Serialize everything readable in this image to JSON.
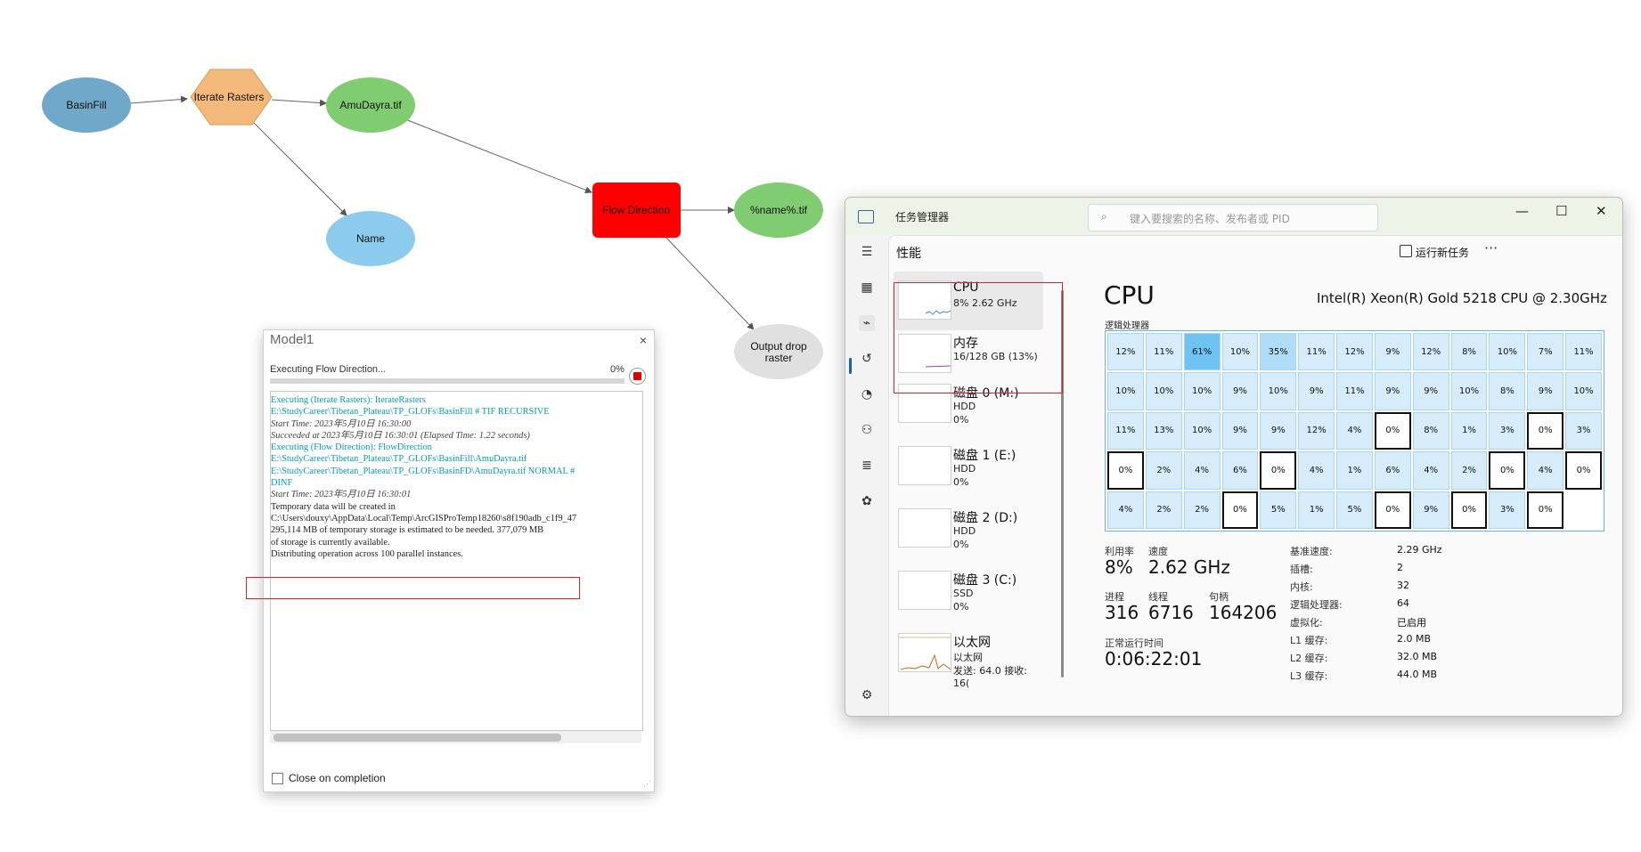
{
  "model_builder": {
    "nodes": {
      "basinfill": "BasinFill",
      "iterate": "Iterate Rasters",
      "amudayra": "AmuDayra.tif",
      "name": "Name",
      "flow_direction": "Flow Direction",
      "name_tif": "%name%.tif",
      "output_drop_line1": "Output drop",
      "output_drop_line2": "raster"
    },
    "colors": {
      "input": "#6fa8c8",
      "iterator": "#f2b97b",
      "derived": "#80cc70",
      "variable": "#8ccbec",
      "tool": "#ff0000",
      "output_optional": "#e0e0e0"
    }
  },
  "gp_dialog": {
    "title": "Model1",
    "close": "×",
    "status": "Executing Flow Direction...",
    "percent_label": "0%",
    "progress": 0,
    "log": [
      {
        "style": "cyan",
        "text": "Executing (Iterate Rasters): IterateRasters"
      },
      {
        "style": "cyan",
        "text": "E:\\StudyCareer\\Tibetan_Plateau\\TP_GLOFs\\BasinFill # TIF RECURSIVE"
      },
      {
        "style": "ital",
        "text": "Start Time: 2023年5月10日 16:30:00"
      },
      {
        "style": "ital",
        "text": "Succeeded at 2023年5月10日 16:30:01 (Elapsed Time: 1.22 seconds)"
      },
      {
        "style": "cyan",
        "text": "Executing (Flow Direction): FlowDirection"
      },
      {
        "style": "cyan",
        "text": "E:\\StudyCareer\\Tibetan_Plateau\\TP_GLOFs\\BasinFill\\AmuDayra.tif"
      },
      {
        "style": "cyan",
        "text": "E:\\StudyCareer\\Tibetan_Plateau\\TP_GLOFs\\BasinFD\\AmuDayra.tif NORMAL #"
      },
      {
        "style": "cyan",
        "text": "DINF"
      },
      {
        "style": "ital",
        "text": "Start Time: 2023年5月10日 16:30:01"
      },
      {
        "style": "plain",
        "text": "Temporary data will be created in"
      },
      {
        "style": "plain",
        "text": "C:\\Users\\douxy\\AppData\\Local\\Temp\\ArcGISProTemp18260\\s8f190adb_c1f9_47"
      },
      {
        "style": "plain",
        "text": "295,114 MB of temporary storage is estimated to be needed. 377,079 MB"
      },
      {
        "style": "plain",
        "text": "of storage is currently available."
      },
      {
        "style": "plain",
        "text": "Distributing operation across 100 parallel instances."
      }
    ],
    "close_on_completion": "Close on completion"
  },
  "task_manager": {
    "title": "任务管理器",
    "search_placeholder": "键入要搜索的名称、发布者或 PID",
    "window": {
      "minimize": "—",
      "maximize": "☐",
      "close": "✕"
    },
    "page_title": "性能",
    "run_new_task": "运行新任务",
    "more": "···",
    "resources": [
      {
        "name": "CPU",
        "sub1": "8% 2.62 GHz",
        "sub2": ""
      },
      {
        "name": "内存",
        "sub1": "16/128 GB (13%)",
        "sub2": ""
      },
      {
        "name": "磁盘 0 (M:)",
        "sub1": "HDD",
        "sub2": "0%"
      },
      {
        "name": "磁盘 1 (E:)",
        "sub1": "HDD",
        "sub2": "0%"
      },
      {
        "name": "磁盘 2 (D:)",
        "sub1": "HDD",
        "sub2": "0%"
      },
      {
        "name": "磁盘 3 (C:)",
        "sub1": "SSD",
        "sub2": "0%"
      },
      {
        "name": "以太网",
        "sub1": "以太网",
        "sub2": "发送: 64.0  接收: 16("
      }
    ],
    "cpu": {
      "heading": "CPU",
      "model": "Intel(R) Xeon(R) Gold 5218 CPU @ 2.30GHz",
      "grid_label": "逻辑处理器",
      "logical_processors": [
        "12%",
        "11%",
        "61%",
        "10%",
        "35%",
        "11%",
        "12%",
        "9%",
        "12%",
        "8%",
        "10%",
        "7%",
        "11%",
        "10%",
        "10%",
        "10%",
        "9%",
        "10%",
        "9%",
        "11%",
        "9%",
        "9%",
        "10%",
        "8%",
        "9%",
        "10%",
        "11%",
        "13%",
        "10%",
        "9%",
        "9%",
        "12%",
        "4%",
        "0%",
        "8%",
        "1%",
        "3%",
        "0%",
        "3%",
        "0%",
        "2%",
        "4%",
        "6%",
        "0%",
        "4%",
        "1%",
        "6%",
        "4%",
        "2%",
        "0%",
        "4%",
        "0%",
        "4%",
        "2%",
        "2%",
        "0%",
        "5%",
        "1%",
        "5%",
        "0%",
        "9%",
        "0%",
        "3%",
        "0%",
        ""
      ],
      "stats": {
        "utilization_label": "利用率",
        "utilization": "8%",
        "speed_label": "速度",
        "speed": "2.62 GHz",
        "processes_label": "进程",
        "processes": "316",
        "threads_label": "线程",
        "threads": "6716",
        "handles_label": "句柄",
        "handles": "164206",
        "uptime_label": "正常运行时间",
        "uptime": "0:06:22:01"
      },
      "info": [
        {
          "k": "基准速度:",
          "v": "2.29 GHz"
        },
        {
          "k": "插槽:",
          "v": "2"
        },
        {
          "k": "内核:",
          "v": "32"
        },
        {
          "k": "逻辑处理器:",
          "v": "64"
        },
        {
          "k": "虚拟化:",
          "v": "已启用"
        },
        {
          "k": "L1 缓存:",
          "v": "2.0 MB"
        },
        {
          "k": "L2 缓存:",
          "v": "32.0 MB"
        },
        {
          "k": "L3 缓存:",
          "v": "44.0 MB"
        }
      ]
    }
  }
}
